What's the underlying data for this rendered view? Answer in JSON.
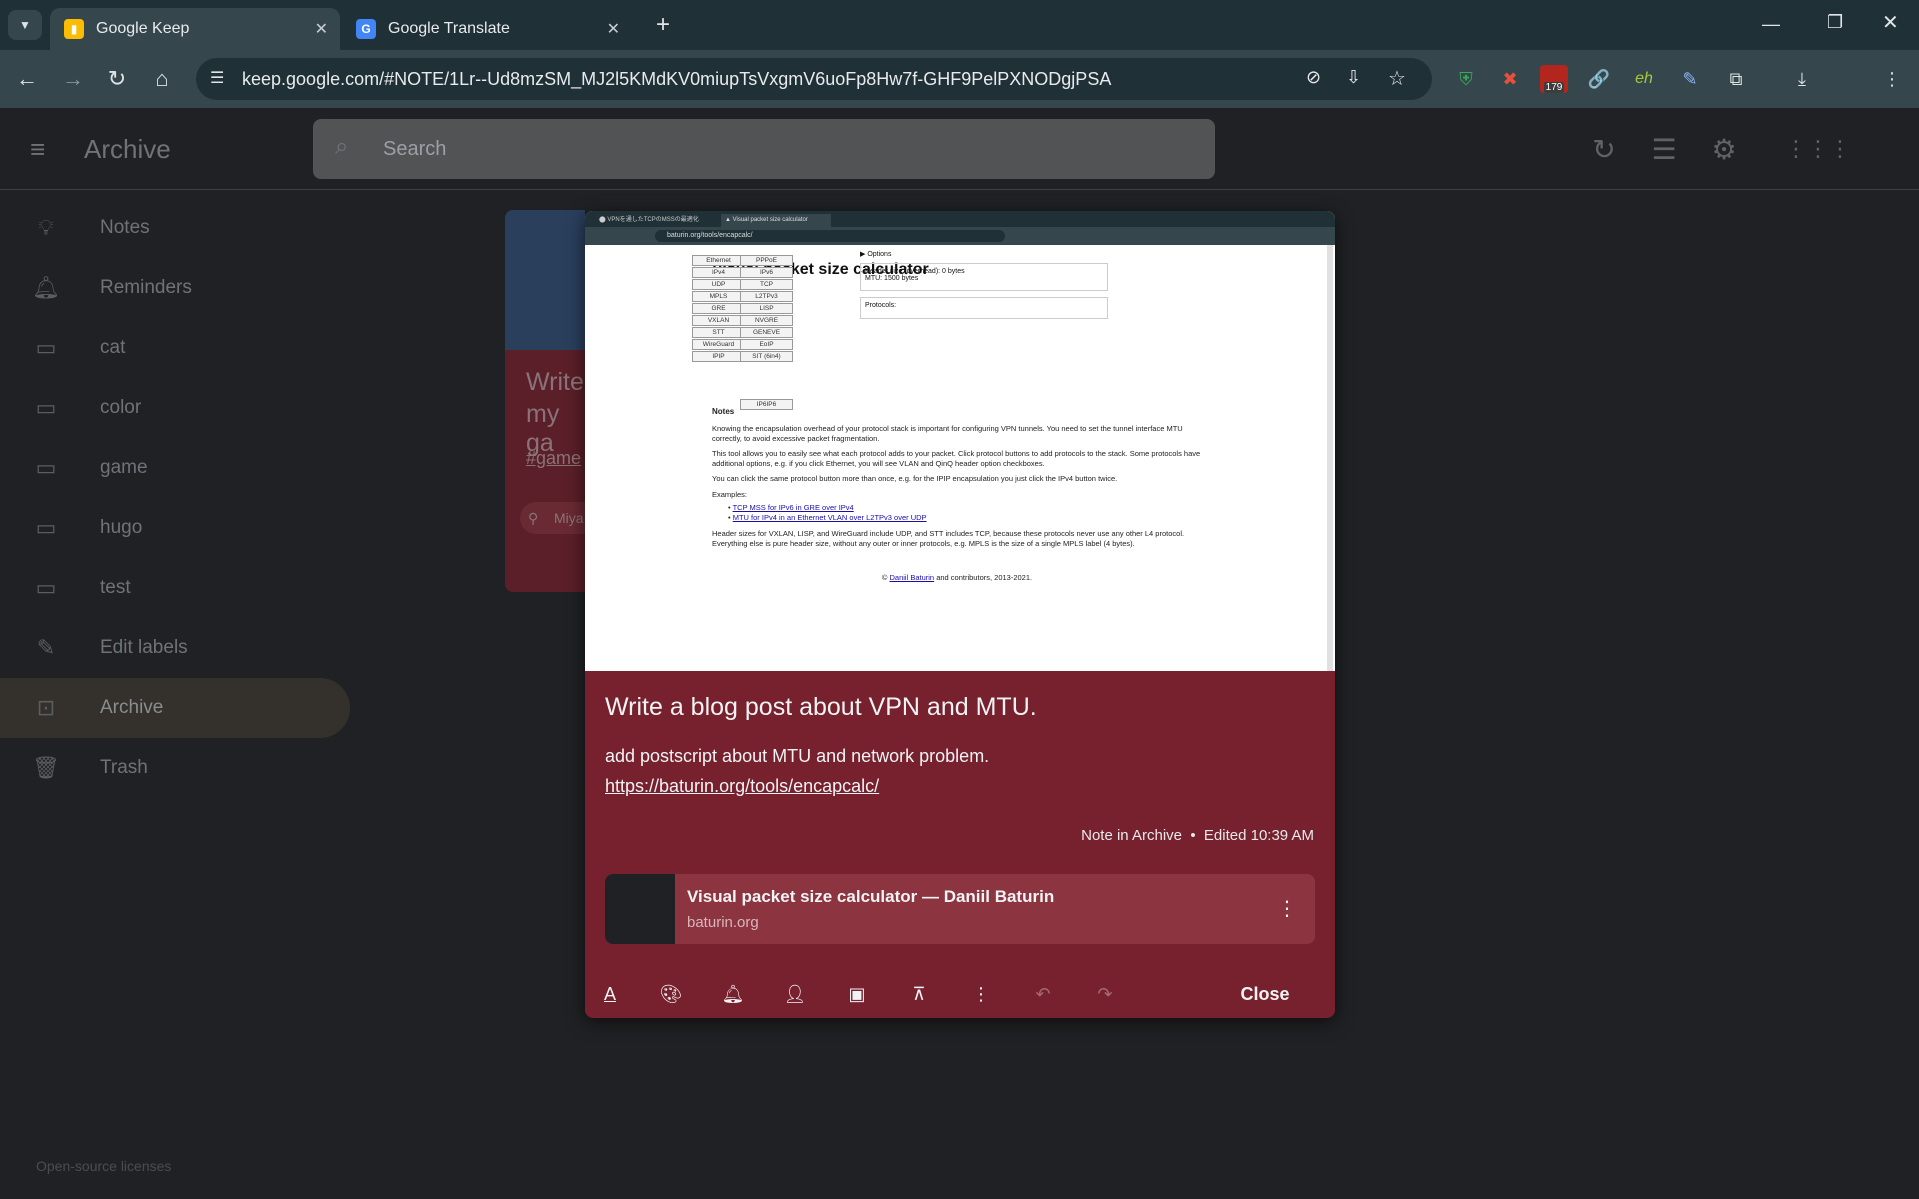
{
  "browser": {
    "tabs": [
      {
        "title": "Google Keep",
        "favicon": "keep-icon",
        "active": true
      },
      {
        "title": "Google Translate",
        "favicon": "translate-icon",
        "active": false
      }
    ],
    "url": "keep.google.com/#NOTE/1Lr--Ud8mzSM_MJ2l5KMdKV0miupTsVxgmV6uoFp8Hw7f-GHF9PelPXNODgjPSA",
    "extension_badge": "179"
  },
  "app": {
    "title": "Archive",
    "search_placeholder": "Search"
  },
  "sidebar": {
    "items": [
      {
        "label": "Notes",
        "icon": "lightbulb-icon"
      },
      {
        "label": "Reminders",
        "icon": "bell-icon"
      },
      {
        "label": "cat",
        "icon": "label-icon"
      },
      {
        "label": "color",
        "icon": "label-icon"
      },
      {
        "label": "game",
        "icon": "label-icon"
      },
      {
        "label": "hugo",
        "icon": "label-icon"
      },
      {
        "label": "test",
        "icon": "label-icon"
      },
      {
        "label": "Edit labels",
        "icon": "pencil-icon"
      },
      {
        "label": "Archive",
        "icon": "archive-icon",
        "active": true
      },
      {
        "label": "Trash",
        "icon": "trash-icon"
      }
    ]
  },
  "background_card": {
    "title_fragment_1": "Write",
    "title_fragment_2": "my ga",
    "tag_fragment": "#game",
    "location_fragment": "Miya"
  },
  "note": {
    "title": "Write a blog post about VPN and MTU.",
    "body_line1": "add postscript about MTU and network problem.",
    "body_link": "https://baturin.org/tools/encapcalc/",
    "meta": "Note in Archive  •  Edited 10:39 AM",
    "link_card": {
      "title": "Visual packet size calculator — Daniil Baturin",
      "domain": "baturin.org"
    },
    "close_label": "Close"
  },
  "embedded_screenshot": {
    "tab1": "VPNを通したTCPのMSSの最適化",
    "tab2": "Visual packet size calculator",
    "url": "baturin.org/tools/encapcalc/",
    "page_title": "Visual packet size calculator",
    "buttons_left": [
      "Ethernet",
      "IPv4",
      "UDP",
      "MPLS",
      "GRE",
      "VXLAN",
      "STT",
      "WireGuard",
      "IPIP"
    ],
    "buttons_right": [
      "PPPoE",
      "IPv6",
      "TCP",
      "L2TPv3",
      "LISP",
      "NVGRE",
      "GENEVE",
      "EoIP",
      "SIT (6in4)"
    ],
    "button_bottom": "IP6IP6",
    "options_label": "▶ Options",
    "header_size": "Header size (overhead): 0 bytes",
    "mtu": "MTU: 1500 bytes",
    "protocols": "Protocols:",
    "notes_heading": "Notes",
    "para1": "Knowing the encapsulation overhead of your protocol stack is important for configuring VPN tunnels. You need to set the tunnel interface MTU correctly, to avoid excessive packet fragmentation.",
    "para2": "This tool allows you to easily see what each protocol adds to your packet. Click protocol buttons to add protocols to the stack. Some protocols have additional options, e.g. if you click Ethernet, you will see VLAN and QinQ header option checkboxes.",
    "para3": "You can click the same protocol button more than once, e.g. for the IPIP encapsulation you just click the IPv4 button twice.",
    "examples_label": "Examples:",
    "example1": "TCP MSS for IPv6 in GRE over IPv4",
    "example2": "MTU for IPv4 in an Ethernet VLAN over L2TPv3 over UDP",
    "para4": "Header sizes for VXLAN, LISP, and WireGuard include UDP, and STT includes TCP, because these protocols never use any other L4 protocol. Everything else is pure header size, without any outer or inner protocols, e.g. MPLS is the size of a single MPLS label (4 bytes).",
    "footer_author": "Daniil Baturin",
    "footer_rest": "and contributors, 2013-2021."
  },
  "footer": "Open-source licenses",
  "colors": {
    "note_bg": "#77202e",
    "link_card_bg": "#8c3541",
    "app_bg": "#202124"
  }
}
